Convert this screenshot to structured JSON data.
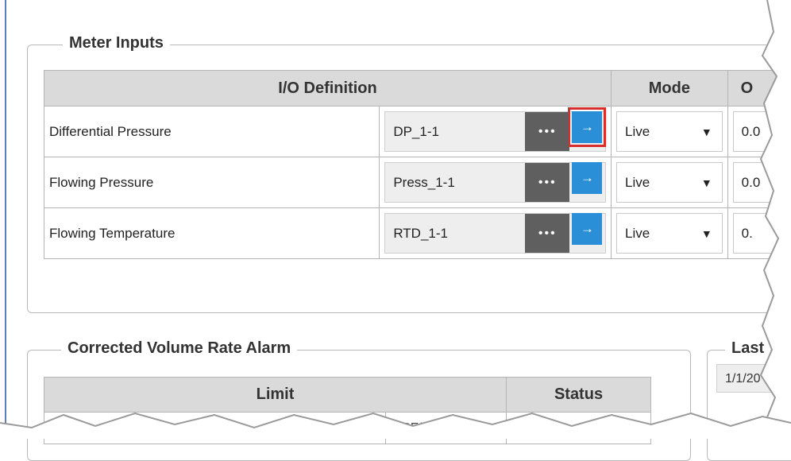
{
  "meter_inputs": {
    "title": "Meter Inputs",
    "headers": {
      "io_definition": "I/O Definition",
      "mode": "Mode",
      "output_partial": "O"
    },
    "rows": [
      {
        "name": "Differential Pressure",
        "io_value": "DP_1-1",
        "browse_label": "•••",
        "link_icon": "right-arrow-icon",
        "mode": "Live",
        "output_partial": "0.0"
      },
      {
        "name": "Flowing Pressure",
        "io_value": "Press_1-1",
        "browse_label": "•••",
        "link_icon": "right-arrow-icon",
        "mode": "Live",
        "output_partial": "0.0"
      },
      {
        "name": "Flowing Temperature",
        "io_value": "RTD_1-1",
        "browse_label": "•••",
        "link_icon": "right-arrow-icon",
        "mode": "Live",
        "output_partial": "0."
      }
    ],
    "mode_caret": "▼",
    "arrow_glyph": "→",
    "selection_color": "#d82d2d"
  },
  "corrected_volume_rate_alarm": {
    "title": "Corrected Volume Rate Alarm",
    "headers": {
      "limit": "Limit",
      "status": "Status"
    },
    "rows": [
      {
        "unit_partial": "MCF/d"
      }
    ]
  },
  "last_group": {
    "title_partial": "Last",
    "date_partial": "1/1/20"
  },
  "colors": {
    "header_bg": "#dadada",
    "browse_button": "#5f5f5f",
    "link_button": "#2a8fd6",
    "window_rule": "#5b7fb8"
  }
}
